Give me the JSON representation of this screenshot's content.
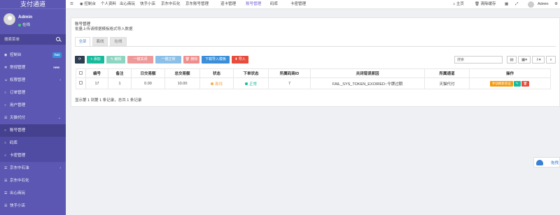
{
  "brand": "支付通道",
  "user": {
    "name": "Admin",
    "status": "在线"
  },
  "search": {
    "placeholder": "搜索菜单"
  },
  "sidebar": {
    "items": [
      {
        "label": "控制台",
        "badge": "hot",
        "badge_color": "#3b8fd9"
      },
      {
        "label": "常规管理",
        "badge": "new",
        "badge_color": "#5c57b2"
      },
      {
        "label": "权限管理",
        "caret": "‹"
      },
      {
        "label": "订单管理"
      },
      {
        "label": "用户管理"
      },
      {
        "label": "天猫代付",
        "caret": "⌄"
      },
      {
        "label": "账号管理"
      },
      {
        "label": "码库"
      },
      {
        "label": "卡密管理"
      },
      {
        "label": "京东中石油",
        "caret": "‹"
      },
      {
        "label": "京东中石化"
      },
      {
        "label": "出心商玩"
      },
      {
        "label": "快手小店"
      }
    ]
  },
  "topnav": {
    "items": [
      "控制台",
      "个人资料",
      "出心商玩",
      "快手小店",
      "京东中石化",
      "京东账号管理",
      "道卡管理",
      "账号管理",
      "码库",
      "卡密管理"
    ],
    "active": "账号管理",
    "right": {
      "home": "主页",
      "clear": "清除缓存",
      "user": "Admin"
    }
  },
  "page": {
    "title": "账号管理",
    "subtitle": "批量上传请根据模板格式导入数据",
    "tabs": [
      "全部",
      "离线",
      "在线"
    ]
  },
  "toolbar": {
    "refresh": "⟳",
    "add": "+ 添加",
    "edit": "✎ 编辑",
    "offline": "一键关闭",
    "online": "一键正常",
    "delete": "🗑 删除",
    "template": "下载导入模板",
    "import": "导入",
    "search_placeholder": "搜索"
  },
  "table": {
    "columns": [
      "编号",
      "备注",
      "日交易额",
      "总交易额",
      "状态",
      "下单状态",
      "所属码商ID",
      "关闭错误原因",
      "所属通道",
      "操作"
    ],
    "rows": [
      {
        "id": "17",
        "remark": "1",
        "day_amount": "0.00",
        "total_amount": "10.00",
        "status": "离线",
        "status_color": "#f0ad4e",
        "order_status": "正常",
        "order_status_color": "#18bc9c",
        "merchant_id": "7",
        "error": "FAIL_SYS_TOKEN_EXOIRED::令牌过期",
        "channel": "天猫代付",
        "op_label": "手动刷新验证"
      }
    ]
  },
  "pager": {
    "text": "显示第 1 到第 1 条记录，总共 1 条记录"
  },
  "cloud": {
    "label": "拖拽"
  },
  "colors": {
    "sidebar": "#5c57b2",
    "refresh": "#2c3e50",
    "add": "#18bc9c",
    "edit": "#8fd6c2",
    "offline": "#ee9a9a",
    "online": "#8dc0e8",
    "delete": "#f08e8e",
    "template": "#3b8fd9",
    "import": "#e74c3c"
  }
}
